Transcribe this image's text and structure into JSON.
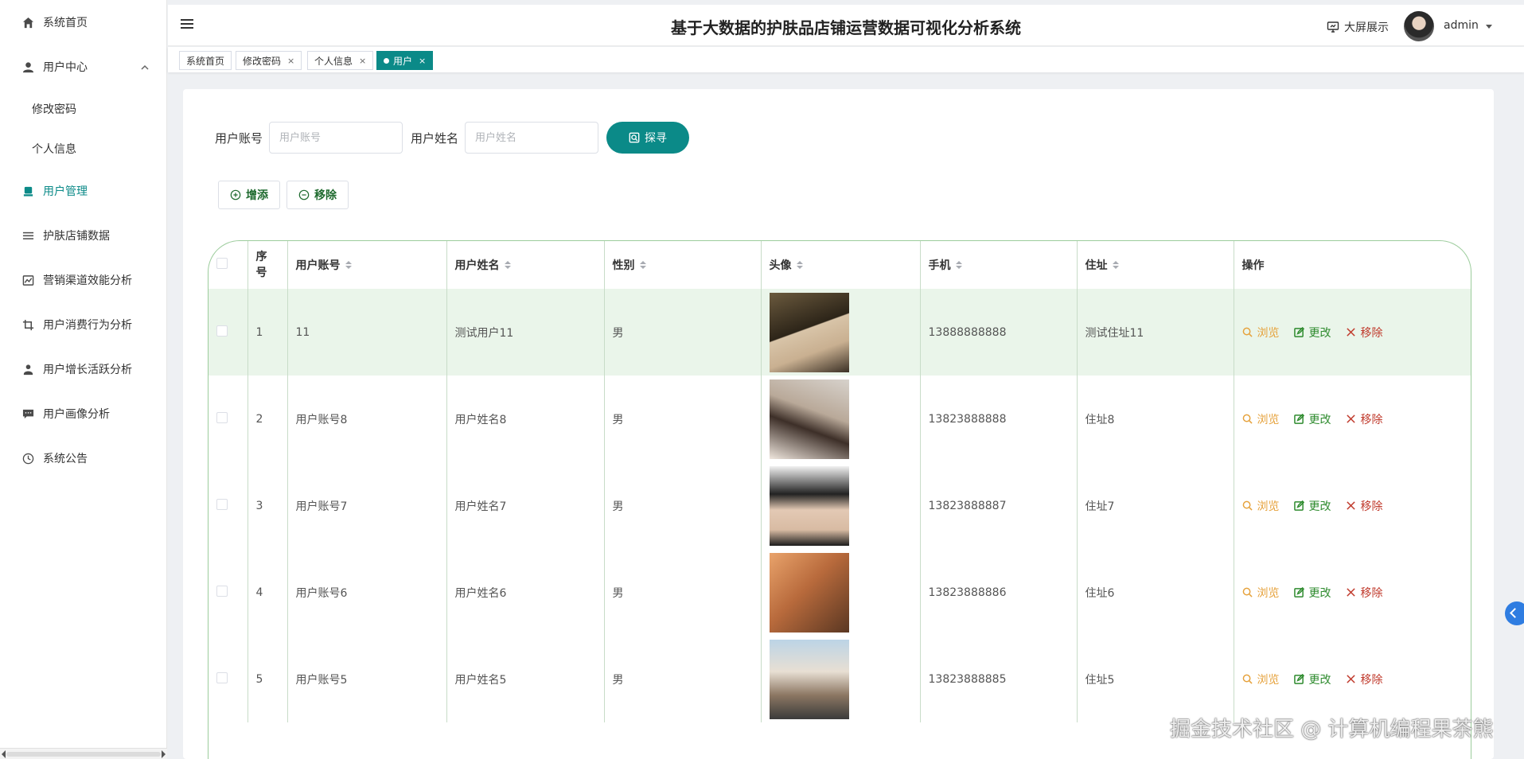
{
  "sidebar": {
    "items": [
      {
        "label": "系统首页",
        "icon": "home-icon"
      },
      {
        "label": "用户中心",
        "icon": "user-icon"
      },
      {
        "label": "修改密码"
      },
      {
        "label": "个人信息"
      },
      {
        "label": "用户管理",
        "icon": "users-icon"
      },
      {
        "label": "护肤店铺数据",
        "icon": "list-icon"
      },
      {
        "label": "营销渠道效能分析",
        "icon": "chart-icon"
      },
      {
        "label": "用户消费行为分析",
        "icon": "crop-icon"
      },
      {
        "label": "用户增长活跃分析",
        "icon": "person-icon"
      },
      {
        "label": "用户画像分析",
        "icon": "chat-icon"
      },
      {
        "label": "系统公告",
        "icon": "clock-icon"
      }
    ]
  },
  "header": {
    "title": "基于大数据的护肤品店铺运营数据可视化分析系统",
    "big_screen": "大屏展示",
    "user": "admin"
  },
  "tabs": [
    {
      "label": "系统首页",
      "closable": false
    },
    {
      "label": "修改密码",
      "closable": true
    },
    {
      "label": "个人信息",
      "closable": true
    },
    {
      "label": "用户",
      "closable": true,
      "active": true
    }
  ],
  "search": {
    "account_label": "用户账号",
    "account_placeholder": "用户账号",
    "name_label": "用户姓名",
    "name_placeholder": "用户姓名",
    "button": "探寻"
  },
  "actions": {
    "add": "增添",
    "remove": "移除"
  },
  "table": {
    "headers": {
      "index": "序号",
      "account": "用户账号",
      "name": "用户姓名",
      "gender": "性别",
      "avatar": "头像",
      "phone": "手机",
      "address": "住址",
      "ops": "操作"
    },
    "ops": {
      "view": "浏览",
      "edit": "更改",
      "delete": "移除"
    },
    "rows": [
      {
        "index": "1",
        "account": "11",
        "name": "测试用户11",
        "gender": "男",
        "phone": "13888888888",
        "address": "测试住址11"
      },
      {
        "index": "2",
        "account": "用户账号8",
        "name": "用户姓名8",
        "gender": "男",
        "phone": "13823888888",
        "address": "住址8"
      },
      {
        "index": "3",
        "account": "用户账号7",
        "name": "用户姓名7",
        "gender": "男",
        "phone": "13823888887",
        "address": "住址7"
      },
      {
        "index": "4",
        "account": "用户账号6",
        "name": "用户姓名6",
        "gender": "男",
        "phone": "13823888886",
        "address": "住址6"
      },
      {
        "index": "5",
        "account": "用户账号5",
        "name": "用户姓名5",
        "gender": "男",
        "phone": "13823888885",
        "address": "住址5"
      }
    ]
  },
  "watermark": "掘金技术社区 @ 计算机编程果茶熊",
  "colors": {
    "primary": "#0b8a88",
    "view": "#e6a23c",
    "edit": "#2e8b2e",
    "delete": "#c0392b"
  }
}
